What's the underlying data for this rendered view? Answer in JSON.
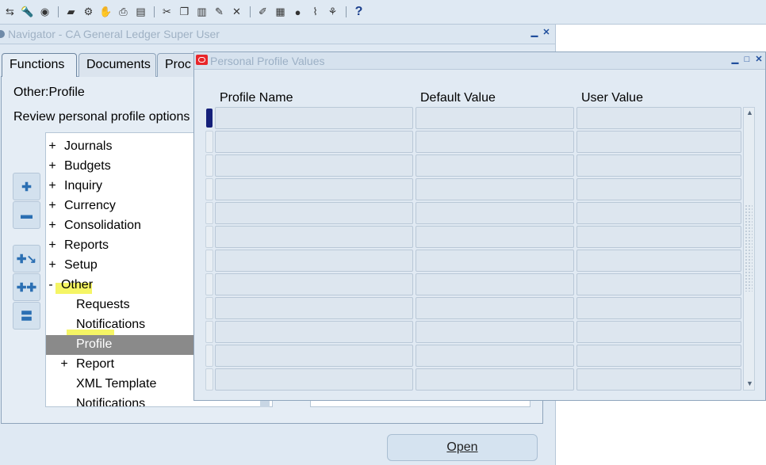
{
  "toolbar": {
    "icons": [
      "nav-icon",
      "flashlight-icon",
      "globe-icon",
      "folder-icon",
      "tools-icon",
      "hand-icon",
      "print-icon",
      "save-icon",
      "cut-icon",
      "copy-icon",
      "paste-icon",
      "edit-icon",
      "clear-icon",
      "pen-icon",
      "folders-icon",
      "ball-icon",
      "attach-icon",
      "translate-icon"
    ],
    "help_label": "?"
  },
  "navigator": {
    "title": "Navigator - CA General Ledger Super User",
    "tabs": [
      "Functions",
      "Documents",
      "Proc"
    ],
    "context_label": "Other:Profile",
    "instruction": "Review personal profile options",
    "tree": [
      {
        "toggle": "+",
        "label": "Journals"
      },
      {
        "toggle": "+",
        "label": "Budgets"
      },
      {
        "toggle": "+",
        "label": "Inquiry"
      },
      {
        "toggle": "+",
        "label": "Currency"
      },
      {
        "toggle": "+",
        "label": "Consolidation"
      },
      {
        "toggle": "+",
        "label": "Reports"
      },
      {
        "toggle": "+",
        "label": "Setup"
      },
      {
        "toggle": "-",
        "label": "Other"
      },
      {
        "toggle": "",
        "label": "Requests"
      },
      {
        "toggle": "",
        "label": "Notifications"
      },
      {
        "toggle": "",
        "label": "Profile"
      },
      {
        "toggle": "+",
        "label": "Report"
      },
      {
        "toggle": "",
        "label": "XML Template"
      },
      {
        "toggle": "",
        "label": "Notifications"
      }
    ],
    "selected_item": "Profile",
    "open_label": "Open"
  },
  "profile_values": {
    "title": "Personal Profile Values",
    "columns": [
      "Profile Name",
      "Default Value",
      "User Value"
    ],
    "row_count_visible": 12,
    "rows": [
      [
        "",
        "",
        ""
      ],
      [
        "",
        "",
        ""
      ],
      [
        "",
        "",
        ""
      ],
      [
        "",
        "",
        ""
      ],
      [
        "",
        "",
        ""
      ],
      [
        "",
        "",
        ""
      ],
      [
        "",
        "",
        ""
      ],
      [
        "",
        "",
        ""
      ],
      [
        "",
        "",
        ""
      ],
      [
        "",
        "",
        ""
      ],
      [
        "",
        "",
        ""
      ],
      [
        "",
        "",
        ""
      ]
    ]
  },
  "colors": {
    "highlight": "#f3f34a",
    "selection": "#8a8a8a",
    "current_row": "#15207a",
    "oracle_red": "#e8262a"
  }
}
